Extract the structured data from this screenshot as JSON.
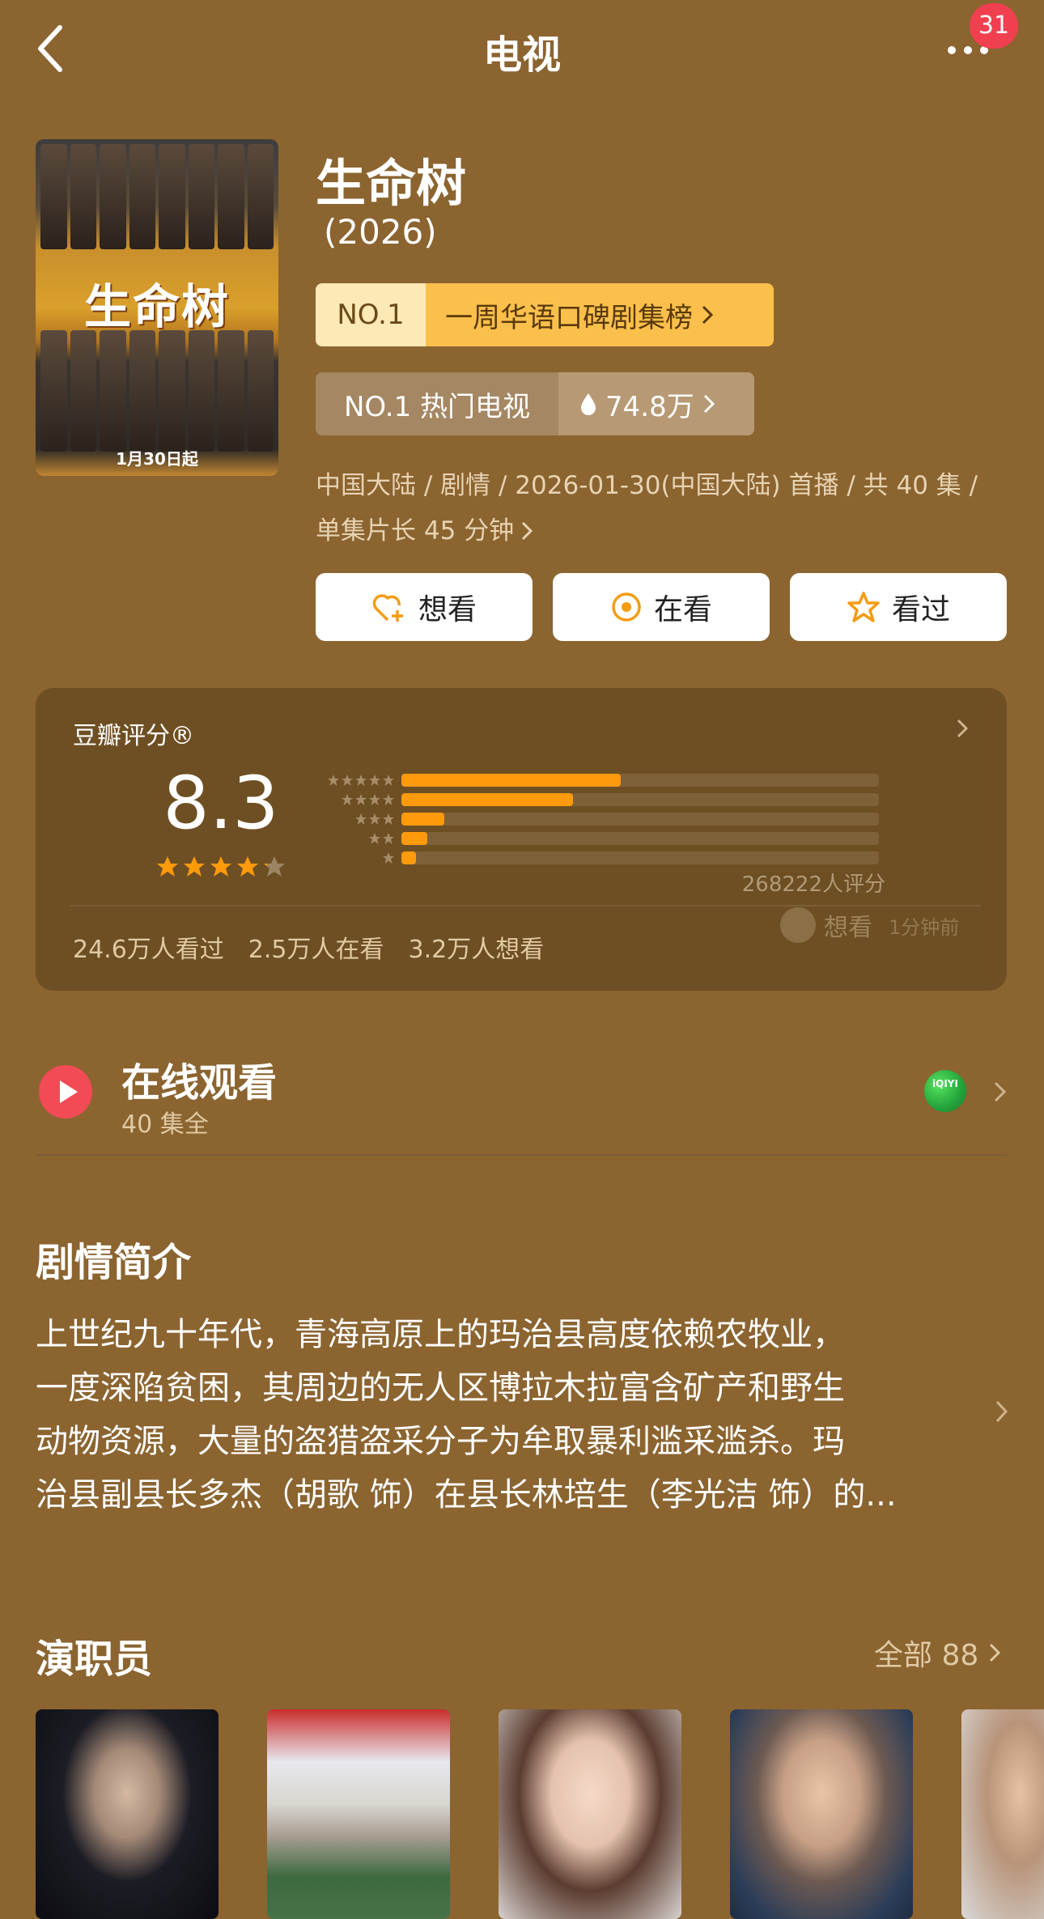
{
  "header": {
    "title": "电视",
    "badge_count": "31"
  },
  "poster": {
    "title_art": "生命树",
    "release_note": "1月30日起"
  },
  "show": {
    "title": "生命树",
    "year": "(2026)"
  },
  "rank_primary": {
    "tag": "NO.1",
    "label": "一周华语口碑剧集榜"
  },
  "rank_secondary": {
    "tag": "NO.1 热门电视",
    "heat": "74.8万"
  },
  "meta": {
    "line1": "中国大陆 / 剧情 / 2026-01-30(中国大陆) 首播 / 共 40 集 /",
    "line2": "单集片长 45 分钟"
  },
  "actions": {
    "want_label": "想看",
    "watching_label": "在看",
    "watched_label": "看过"
  },
  "rating": {
    "title": "豆瓣评分®",
    "score": "8.3",
    "star_value": 4.15,
    "distribution": [
      0.46,
      0.36,
      0.09,
      0.055,
      0.03
    ],
    "count_label": "268222人评分",
    "watched": "24.6万人看过",
    "watching": "2.5万人在看",
    "wanting": "3.2万人想看",
    "activity_label": "想看",
    "activity_time": "1分钟前"
  },
  "online": {
    "title": "在线观看",
    "subtitle": "40 集全",
    "provider_icon_text": "iQIYI"
  },
  "synopsis": {
    "title": "剧情简介",
    "line1": "上世纪九十年代，青海高原上的玛治县高度依赖农牧业，",
    "line2": "一度深陷贫困，其周边的无人区博拉木拉富含矿产和野生",
    "line3": "动物资源，大量的盗猎盗采分子为牟取暴利滥采滥杀。玛",
    "line4": "治县副县长多杰（胡歌 饰）在县长林培生（李光洁 饰）的..."
  },
  "cast": {
    "title": "演职员",
    "all_label": "全部 88"
  },
  "colors": {
    "background": "#8b6430",
    "accent_orange": "#ff9a0c",
    "badge_red": "#f04050",
    "play_red": "#f24b56"
  }
}
